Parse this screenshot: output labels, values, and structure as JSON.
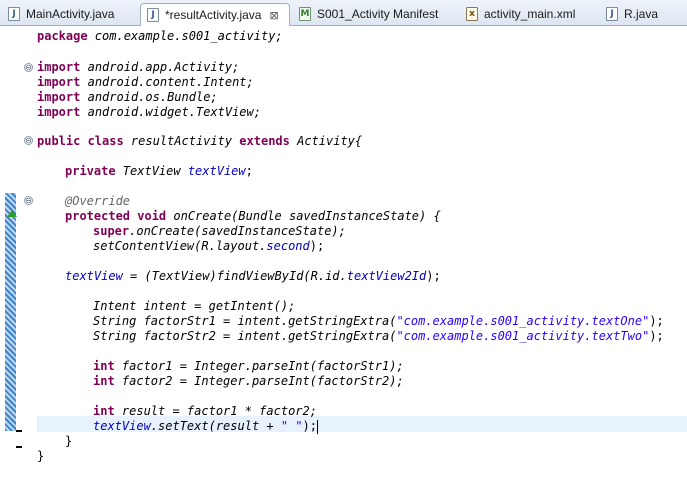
{
  "tabs": [
    {
      "label": "MainActivity.java",
      "icon": "java-file-icon"
    },
    {
      "label": "*resultActivity.java",
      "icon": "java-file-icon",
      "close": "⊠"
    },
    {
      "label": "S001_Activity Manifest",
      "icon": "manifest-file-icon"
    },
    {
      "label": "activity_main.xml",
      "icon": "xml-file-icon"
    },
    {
      "label": "R.java",
      "icon": "java-file-icon"
    }
  ],
  "icon_glyphs": {
    "java": "J",
    "xml": "x",
    "manifest": "M"
  },
  "fold_glyph": "⊖",
  "code": {
    "pkg_kw": "package",
    "pkg_name": " com.example.s001_activity;",
    "imports": [
      "android.app.Activity;",
      "android.content.Intent;",
      "android.os.Bundle;",
      "android.widget.TextView;"
    ],
    "import_kw": "import",
    "class_mod": "public class",
    "class_name": " resultActivity ",
    "extends_kw": "extends",
    "class_rest": " Activity{",
    "private_kw": "private",
    "tv_type": " TextView ",
    "tv_field": "textView",
    "semi": ";",
    "override": "@Override",
    "prot_void": "protected void",
    "oncreate_sig": " onCreate(Bundle savedInstanceState) {",
    "super_kw": "super",
    "super_rest": ".onCreate(savedInstanceState);",
    "setcontent_a": "setContentView(R.layout.",
    "setcontent_field": "second",
    "setcontent_b": ");",
    "find_a": " = (TextView)findViewById(R.id.",
    "find_field": "textView2Id",
    "find_b": ");",
    "intent_line": "Intent intent = getIntent();",
    "f1_a": "String factorStr1 = intent.getStringExtra(",
    "f1_str": "\"com.example.s001_activity.textOne\"",
    "f2_a": "String factorStr2 = intent.getStringExtra(",
    "f2_str": "\"com.example.s001_activity.textTwo\"",
    "str_end": ");",
    "int_kw": "int",
    "fac1_rest": " factor1 = Integer.parseInt(factorStr1);",
    "fac2_rest": " factor2 = Integer.parseInt(factorStr2);",
    "result_rest": " result = factor1 * factor2;",
    "settext_a": ".setText(result + ",
    "settext_str": "\" \"",
    "settext_b": ");",
    "close_brace": "}"
  },
  "colors": {
    "keyword": "#7f0055",
    "field": "#0000c0",
    "string": "#2a00ff",
    "annotation": "#646464",
    "current_line": "#e8f2fe"
  }
}
